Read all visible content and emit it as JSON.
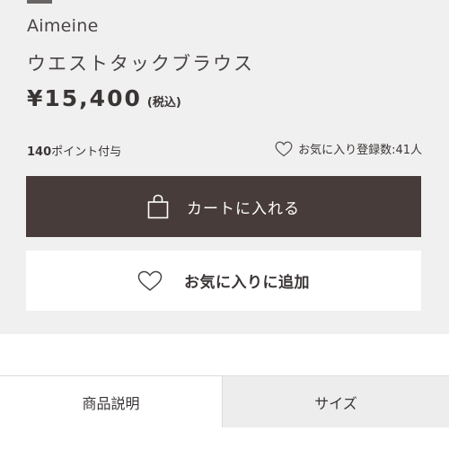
{
  "product": {
    "brand": "Aimeine",
    "name": "ウエストタックブラウス",
    "price": "¥15,400",
    "tax_label": "(税込)"
  },
  "points": {
    "value": "140",
    "label": "ポイント付与"
  },
  "favorites": {
    "label": "お気に入り登録数:41人",
    "icon": "heart-outline-icon"
  },
  "actions": {
    "cart_label": "カートに入れる",
    "cart_icon": "shopping-bag-icon",
    "favorite_label": "お気に入りに追加",
    "favorite_icon": "heart-outline-icon"
  },
  "tabs": [
    {
      "label": "商品説明",
      "active": true
    },
    {
      "label": "サイズ",
      "active": false
    }
  ],
  "colors": {
    "panel_bg": "#f1f0f0",
    "cart_button_bg": "#473c39",
    "text": "#3a3535"
  }
}
